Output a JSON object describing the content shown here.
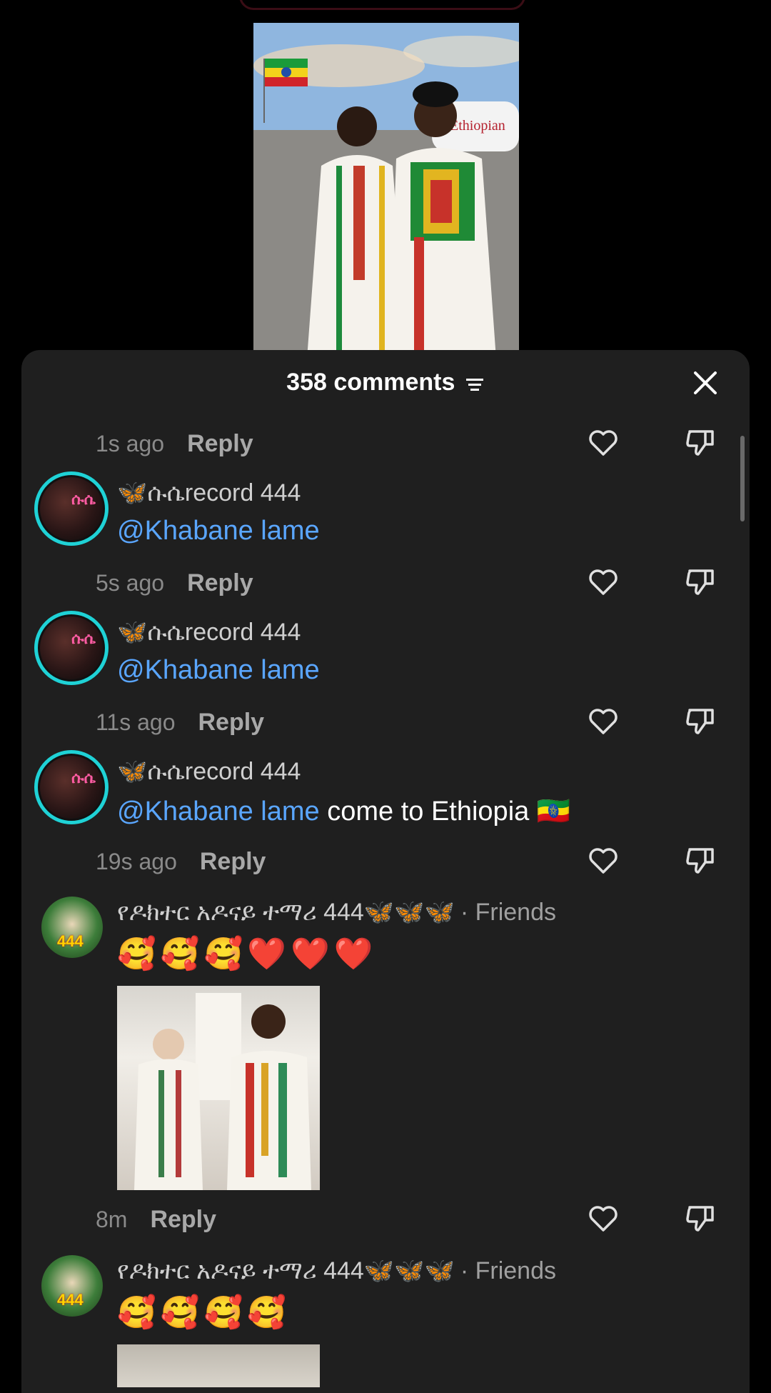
{
  "sheet": {
    "title": "358 comments"
  },
  "comments": [
    {
      "meta": {
        "time": "1s ago",
        "reply": "Reply"
      }
    },
    {
      "username": "🦋ሱሴrecord 444",
      "avatar_label": "ሱሴ",
      "mention": "@Khabane lame",
      "text": "",
      "meta": {
        "time": "5s ago",
        "reply": "Reply"
      }
    },
    {
      "username": "🦋ሱሴrecord 444",
      "avatar_label": "ሱሴ",
      "mention": "@Khabane lame",
      "text": "",
      "meta": {
        "time": "11s ago",
        "reply": "Reply"
      }
    },
    {
      "username": "🦋ሱሴrecord 444",
      "avatar_label": "ሱሴ",
      "mention": "@Khabane lame",
      "text": " come to Ethiopia 🇪🇹",
      "meta": {
        "time": "19s ago",
        "reply": "Reply"
      }
    },
    {
      "username": "የዶክተር አዶናይ ተማሪ 444🦋🦋🦋",
      "friends": "· Friends",
      "avatar_badge": "444",
      "emojis": "🥰🥰🥰❤️❤️❤️",
      "meta": {
        "time": "8m",
        "reply": "Reply"
      }
    },
    {
      "username": "የዶክተር አዶናይ ተማሪ 444🦋🦋🦋",
      "friends": "· Friends",
      "avatar_badge": "444",
      "emojis": "🥰🥰🥰🥰"
    }
  ],
  "video": {
    "plane_text": "Ethiopian"
  },
  "colors": {
    "sheet_bg": "#1f1f1f",
    "mention": "#5aa6ff",
    "avatar_ring": "#1fd2d6"
  }
}
